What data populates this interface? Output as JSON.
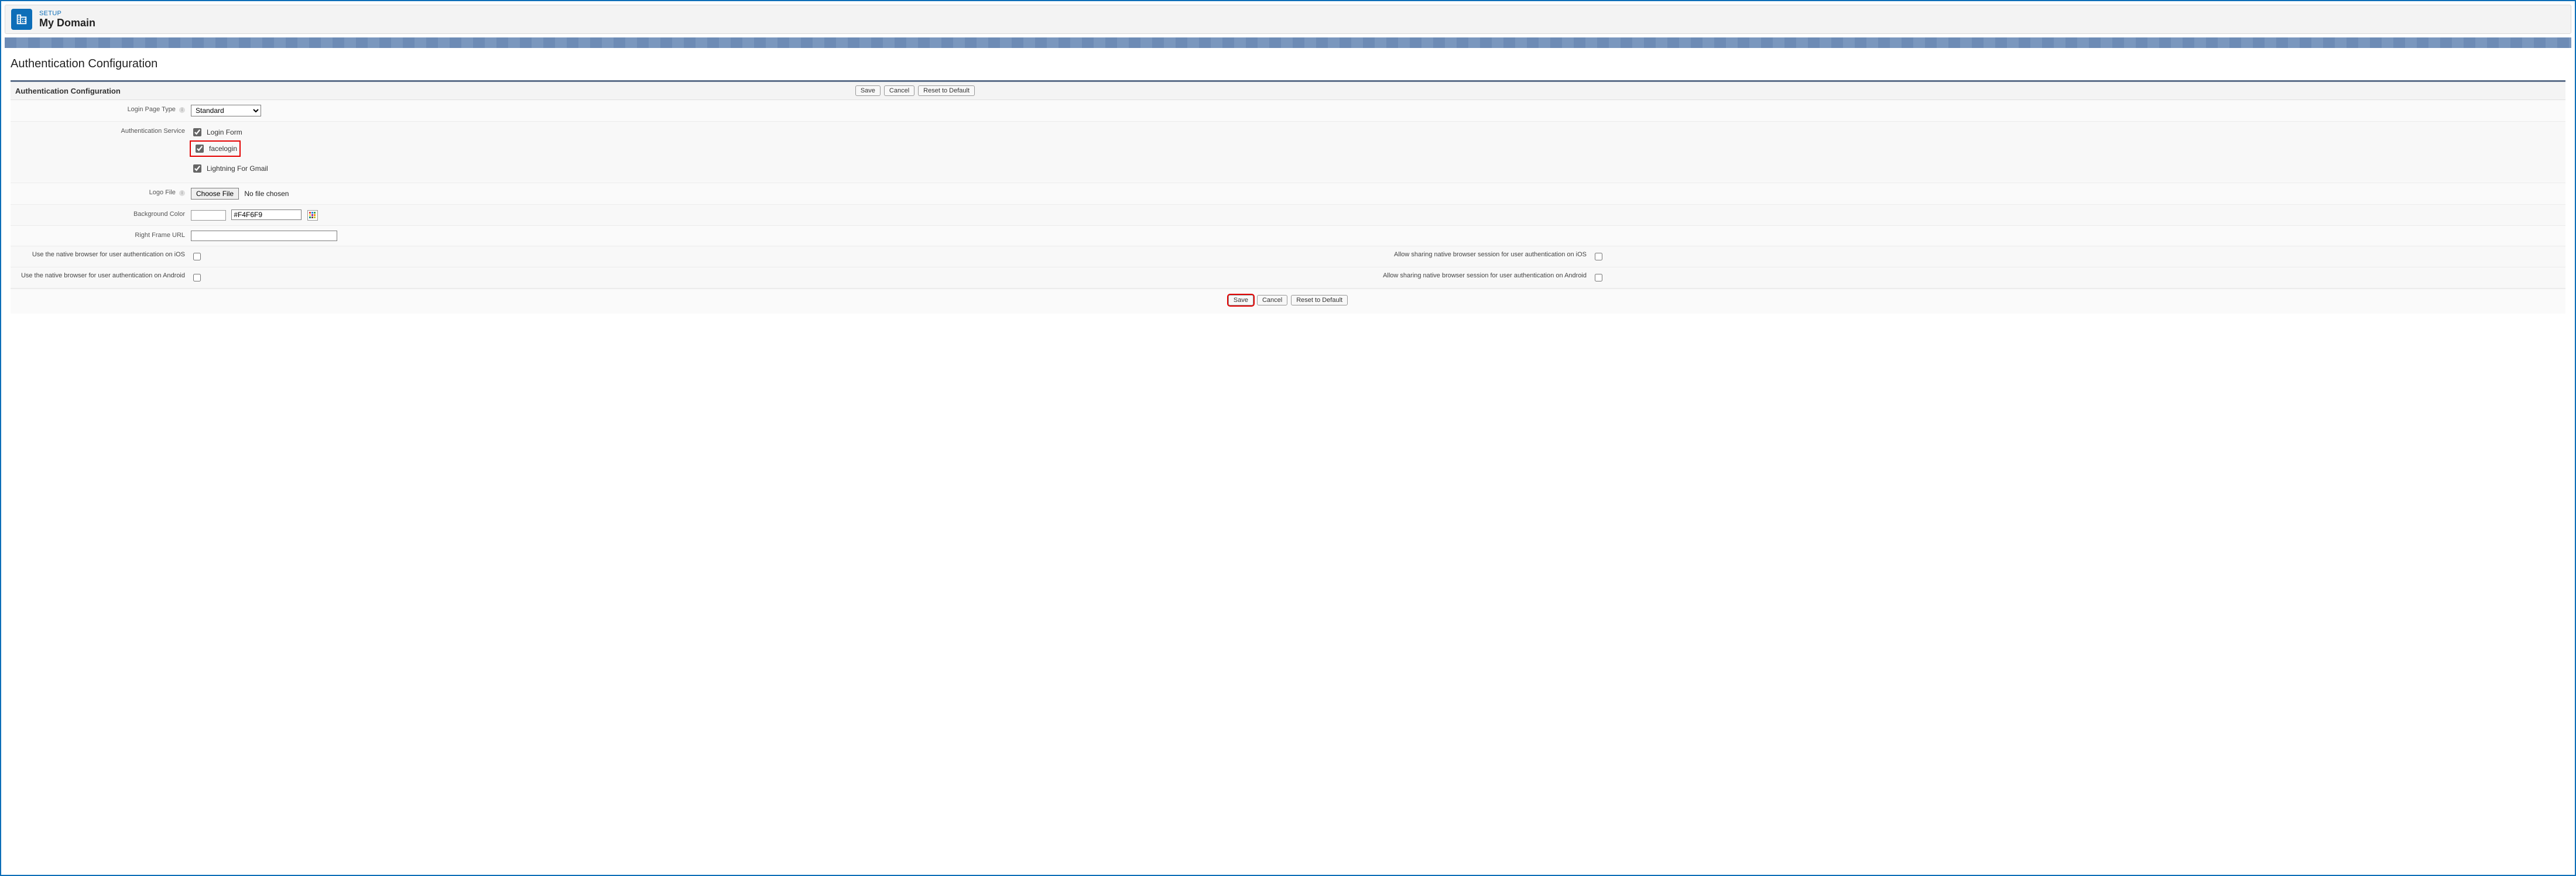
{
  "header": {
    "eyebrow": "SETUP",
    "title": "My Domain"
  },
  "page": {
    "title": "Authentication Configuration"
  },
  "section": {
    "title": "Authentication Configuration",
    "buttons": {
      "save": "Save",
      "cancel": "Cancel",
      "reset": "Reset to Default"
    }
  },
  "form": {
    "login_page_type": {
      "label": "Login Page Type",
      "value": "Standard"
    },
    "auth_service": {
      "label": "Authentication Service",
      "options": [
        {
          "label": "Login Form",
          "checked": true,
          "highlight": false
        },
        {
          "label": "facelogin",
          "checked": true,
          "highlight": true
        },
        {
          "label": "Lightning For Gmail",
          "checked": true,
          "highlight": false
        }
      ]
    },
    "logo_file": {
      "label": "Logo File",
      "button": "Choose File",
      "status": "No file chosen"
    },
    "background_color": {
      "label": "Background Color",
      "value": "#F4F6F9"
    },
    "right_frame_url": {
      "label": "Right Frame URL",
      "value": ""
    },
    "native_ios": {
      "label": "Use the native browser for user authentication on iOS",
      "checked": false
    },
    "allow_share_ios": {
      "label": "Allow sharing native browser session for user authentication on iOS",
      "checked": false
    },
    "native_android": {
      "label": "Use the native browser for user authentication on Android",
      "checked": false
    },
    "allow_share_android": {
      "label": "Allow sharing native browser session for user authentication on Android",
      "checked": false
    }
  },
  "footer_buttons": {
    "save": "Save",
    "cancel": "Cancel",
    "reset": "Reset to Default"
  }
}
